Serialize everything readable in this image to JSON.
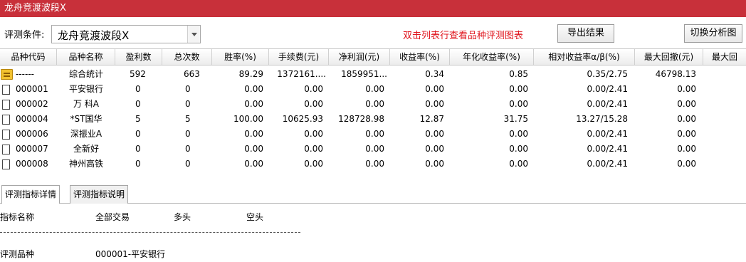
{
  "window": {
    "title": "龙舟竞渡波段X"
  },
  "toolbar": {
    "condition_label": "评测条件:",
    "condition_value": "龙舟竞渡波段X",
    "hint": "双击列表行查看品种评测图表",
    "export_label": "导出结果",
    "switch_label": "切换分析图"
  },
  "table": {
    "headers": [
      "品种代码",
      "品种名称",
      "盈利数",
      "总次数",
      "胜率(%)",
      "手续费(元)",
      "净利润(元)",
      "收益率(%)",
      "年化收益率(%)",
      "相对收益率α/β(%)",
      "最大回撤(元)",
      "最大回"
    ],
    "rows": [
      [
        "------",
        "综合统计",
        "592",
        "663",
        "89.29",
        "1372161....",
        "1859951...",
        "0.34",
        "0.85",
        "0.35/2.75",
        "46798.13"
      ],
      [
        "000001",
        "平安银行",
        "0",
        "0",
        "0.00",
        "0.00",
        "0.00",
        "0.00",
        "0.00",
        "0.00/2.41",
        "0.00"
      ],
      [
        "000002",
        "万 科A",
        "0",
        "0",
        "0.00",
        "0.00",
        "0.00",
        "0.00",
        "0.00",
        "0.00/2.41",
        "0.00"
      ],
      [
        "000004",
        "*ST国华",
        "5",
        "5",
        "100.00",
        "10625.93",
        "128728.98",
        "12.87",
        "31.75",
        "13.27/15.28",
        "0.00"
      ],
      [
        "000006",
        "深振业A",
        "0",
        "0",
        "0.00",
        "0.00",
        "0.00",
        "0.00",
        "0.00",
        "0.00/2.41",
        "0.00"
      ],
      [
        "000007",
        "全新好",
        "0",
        "0",
        "0.00",
        "0.00",
        "0.00",
        "0.00",
        "0.00",
        "0.00/2.41",
        "0.00"
      ],
      [
        "000008",
        "神州高铁",
        "0",
        "0",
        "0.00",
        "0.00",
        "0.00",
        "0.00",
        "0.00",
        "0.00/2.41",
        "0.00"
      ]
    ]
  },
  "tabs": [
    "评测指标详情",
    "评测指标说明"
  ],
  "detail": {
    "col_headers": [
      "指标名称",
      "全部交易",
      "多头",
      "空头"
    ],
    "line1_label": "评测品种",
    "line1_value": "000001-平安银行"
  }
}
